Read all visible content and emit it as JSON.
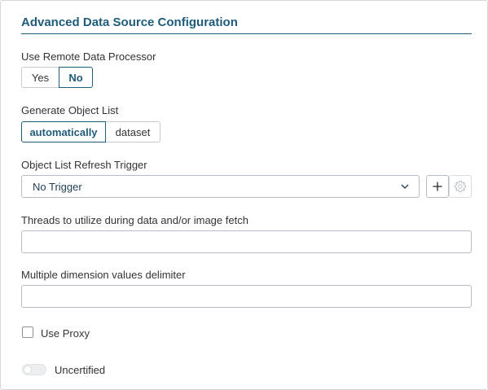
{
  "section": {
    "title": "Advanced Data Source Configuration"
  },
  "remote_processor": {
    "label": "Use Remote Data Processor",
    "options": [
      "Yes",
      "No"
    ],
    "selected": "No"
  },
  "object_list": {
    "label": "Generate Object List",
    "options": [
      "automatically",
      "dataset"
    ],
    "selected": "automatically"
  },
  "refresh_trigger": {
    "label": "Object List Refresh Trigger",
    "value": "No Trigger",
    "add_icon": "plus-icon",
    "settings_icon": "gear-icon"
  },
  "threads": {
    "label": "Threads to utilize during data and/or image fetch",
    "value": ""
  },
  "delimiter": {
    "label": "Multiple dimension values delimiter",
    "value": ""
  },
  "proxy": {
    "label": "Use Proxy",
    "checked": false
  },
  "certified": {
    "label": "Uncertified",
    "on": false
  },
  "colors": {
    "accent": "#1f5c7a",
    "border": "#b5bcc3"
  }
}
